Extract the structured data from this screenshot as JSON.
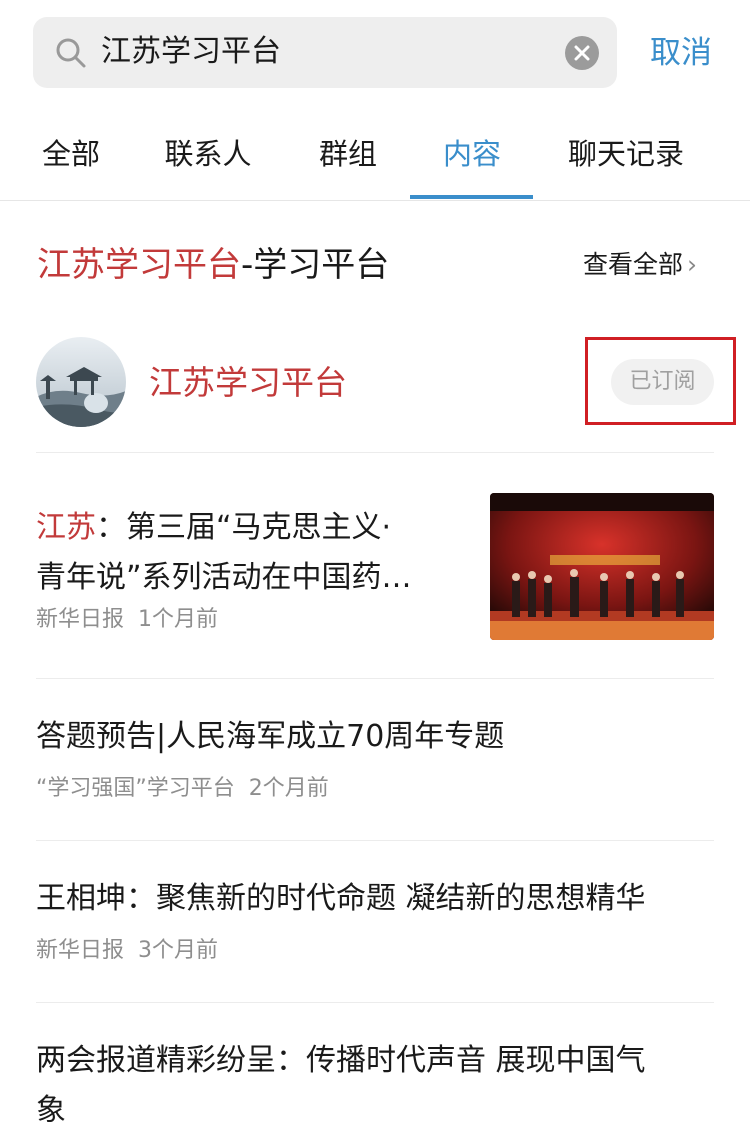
{
  "search": {
    "query": "江苏学习平台",
    "cancel_label": "取消"
  },
  "tabs": [
    {
      "label": "全部"
    },
    {
      "label": "联系人"
    },
    {
      "label": "群组"
    },
    {
      "label": "内容",
      "active": true
    },
    {
      "label": "聊天记录"
    }
  ],
  "section": {
    "title_highlight": "江苏学习平台",
    "title_rest": "-学习平台",
    "view_all_label": "查看全部"
  },
  "account": {
    "name": "江苏学习平台",
    "subscribe_label": "已订阅"
  },
  "news": [
    {
      "title_highlight": "江苏",
      "title_line1_rest": "：第三届“马克思主义·",
      "title_line2": "青年说”系列活动在中国药…",
      "source": "新华日报",
      "time": "1个月前"
    },
    {
      "title": "答题预告|人民海军成立70周年专题",
      "source": "“学习强国”学习平台",
      "time": "2个月前"
    },
    {
      "title": "王相坤：聚焦新的时代命题 凝结新的思想精华",
      "source": "新华日报",
      "time": "3个月前"
    },
    {
      "title_line1": "两会报道精彩纷呈：传播时代声音 展现中国气",
      "title_line2": "象"
    }
  ],
  "colors": {
    "accent_blue": "#3a8ecb",
    "highlight_red": "#c23a3a",
    "frame_red": "#d01f24"
  }
}
